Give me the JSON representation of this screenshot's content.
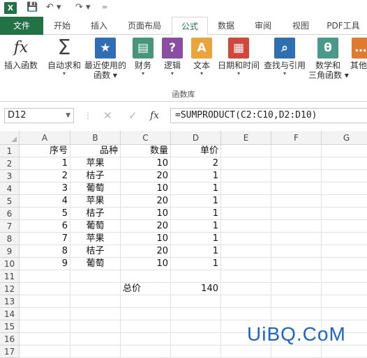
{
  "qat": {
    "app_icon": "X",
    "save_icon": "save-icon",
    "undo_icon": "undo-icon",
    "redo_icon": "redo-icon"
  },
  "tabs": [
    "文件",
    "开始",
    "插入",
    "页面布局",
    "公式",
    "数据",
    "审阅",
    "视图",
    "PDF工具"
  ],
  "ribbon": {
    "buttons": [
      {
        "label": "插入函数",
        "icon": "fx"
      },
      {
        "label": "自动求和",
        "icon": "Σ"
      },
      {
        "label": "最近使用的",
        "label2": "函数",
        "icon": "★"
      },
      {
        "label": "财务",
        "icon": "▤"
      },
      {
        "label": "逻辑",
        "icon": "?"
      },
      {
        "label": "文本",
        "icon": "A"
      },
      {
        "label": "日期和时间",
        "icon": "▦"
      },
      {
        "label": "查找与引用",
        "icon": "⌕"
      },
      {
        "label": "数学和",
        "label2": "三角函数",
        "icon": "θ"
      },
      {
        "label": "其他",
        "icon": "…"
      }
    ],
    "group_label": "函数库"
  },
  "formula_bar": {
    "name_box": "D12",
    "fx_label": "fx",
    "formula": "=SUMPRODUCT(C2:C10,D2:D10)"
  },
  "sheet": {
    "columns": [
      "A",
      "B",
      "C",
      "D",
      "E",
      "F",
      "G"
    ],
    "rows": [
      "1",
      "2",
      "3",
      "4",
      "5",
      "6",
      "7",
      "8",
      "9",
      "10",
      "11",
      "12",
      "13",
      "14",
      "15",
      "16",
      "17"
    ],
    "header": [
      "序号",
      "品种",
      "数量",
      "单价"
    ],
    "data": [
      [
        "1",
        "苹果",
        "10",
        "2"
      ],
      [
        "2",
        "桔子",
        "20",
        "1"
      ],
      [
        "3",
        "葡萄",
        "10",
        "1"
      ],
      [
        "4",
        "苹果",
        "20",
        "1"
      ],
      [
        "5",
        "桔子",
        "10",
        "1"
      ],
      [
        "6",
        "葡萄",
        "20",
        "1"
      ],
      [
        "7",
        "苹果",
        "10",
        "1"
      ],
      [
        "8",
        "桔子",
        "20",
        "1"
      ],
      [
        "9",
        "葡萄",
        "10",
        "1"
      ]
    ],
    "total_label": "总价",
    "total_value": "140"
  },
  "watermark": "UiBQ.CoM",
  "colors": {
    "excel_green": "#217346",
    "watermark_blue": "#1a66c4"
  }
}
